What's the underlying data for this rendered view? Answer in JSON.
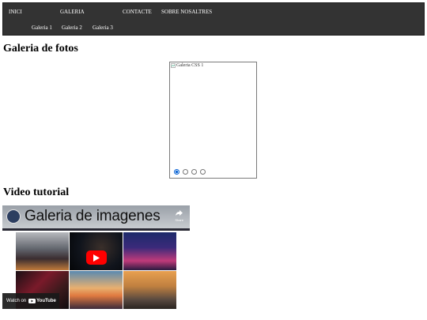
{
  "nav": {
    "items": [
      "INICI",
      "GALERIA",
      "CONTACTE",
      "SOBRE NOSALTRES"
    ],
    "submenu": [
      "Galeria 1",
      "Galeria 2",
      "Galeria 3"
    ]
  },
  "gallery": {
    "heading": "Galeria de fotos",
    "image_alt": "Galeria CSS 1",
    "slides": 4,
    "selected_slide": 1
  },
  "video": {
    "heading": "Video tutorial",
    "title": "Galeria de imagenes",
    "watch_on": "Watch on",
    "youtube": "YouTube",
    "share": "Share"
  },
  "colors": {
    "nav_bg": "#333333",
    "play_button": "#ff0000",
    "radio_selected": "#0a64d4"
  }
}
